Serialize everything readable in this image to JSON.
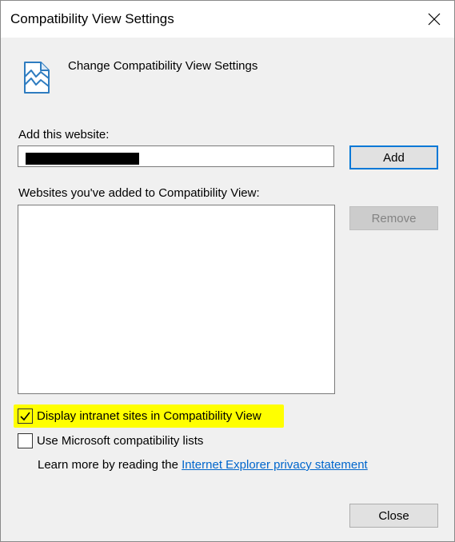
{
  "window": {
    "title": "Compatibility View Settings",
    "close_icon": "close-icon"
  },
  "header": {
    "icon": "compatibility-view-icon",
    "text": "Change Compatibility View Settings"
  },
  "add_website": {
    "label": "Add this website:",
    "value": "",
    "value_redacted": true,
    "button_label": "Add"
  },
  "websites_list": {
    "label": "Websites you've added to Compatibility View:",
    "items": [],
    "remove_label": "Remove",
    "remove_enabled": false
  },
  "options": {
    "intranet": {
      "label": "Display intranet sites in Compatibility View",
      "checked": true,
      "highlight_color": "#ffff00"
    },
    "ms_lists": {
      "label": "Use Microsoft compatibility lists",
      "checked": false
    }
  },
  "learn_more": {
    "text": "Learn more by reading the ",
    "link_text": "Internet Explorer privacy statement"
  },
  "footer": {
    "close_label": "Close"
  },
  "colors": {
    "accent": "#0078d7",
    "link": "#0066cc",
    "dialog_bg": "#f0f0f0"
  }
}
